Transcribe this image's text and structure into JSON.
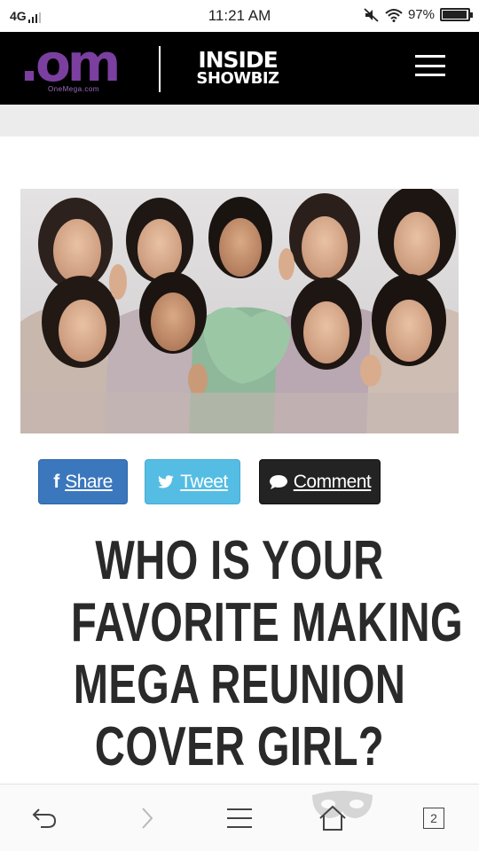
{
  "status_bar": {
    "network": "4G",
    "time": "11:21 AM",
    "battery": "97%",
    "battery_level": 0.97
  },
  "header": {
    "logo_text": ".om",
    "logo_subtext": "OneMega.com",
    "brand_line1": "INSIDE",
    "brand_line2": "SHOWBIZ",
    "menu_icon": "hamburger-menu-icon"
  },
  "share": {
    "share_label": "Share",
    "tweet_label": "Tweet",
    "comment_label": "Comment",
    "colors": {
      "share": "#3b77bd",
      "tweet": "#55bde3",
      "comment": "#232323"
    }
  },
  "article": {
    "headline": [
      "WHO IS YOUR",
      "FAVORITE MAKING",
      "MEGA REUNION",
      "COVER GIRL?"
    ]
  },
  "browser": {
    "tab_count": "2",
    "icons": [
      "back-icon",
      "forward-icon",
      "menu-icon",
      "home-icon",
      "tabs-icon"
    ]
  },
  "colors": {
    "header_bg": "#000000",
    "logo_purple": "#7b3fa0",
    "band_grey": "#ececec",
    "headline": "#2a2a2a"
  }
}
